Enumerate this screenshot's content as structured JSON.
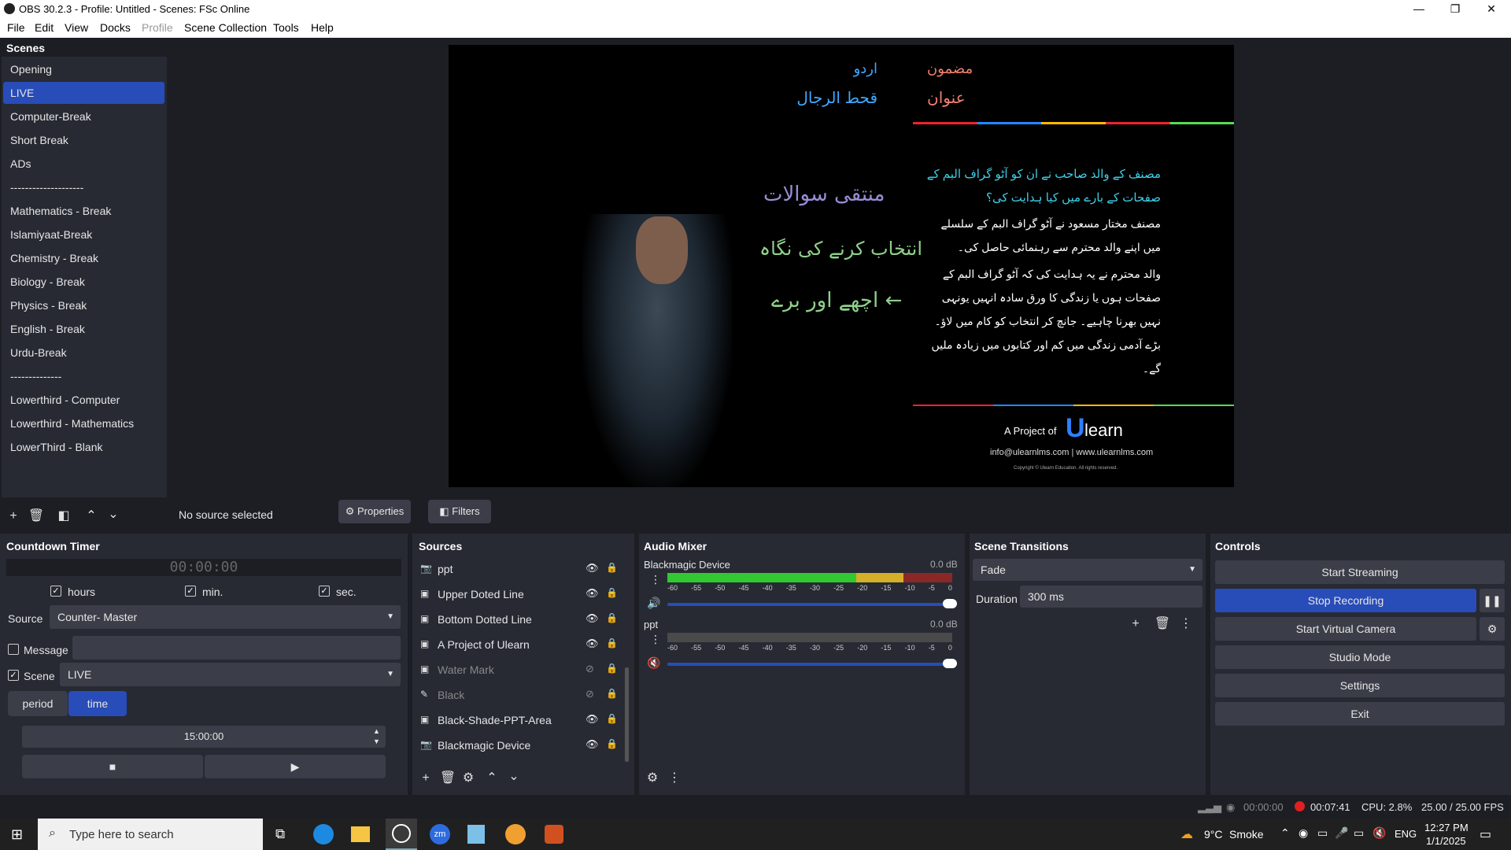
{
  "window": {
    "title": "OBS 30.2.3 - Profile: Untitled - Scenes: FSc Online"
  },
  "menu": [
    "File",
    "Edit",
    "View",
    "Docks",
    "Profile",
    "Scene Collection",
    "Tools",
    "Help"
  ],
  "scenes": {
    "title": "Scenes",
    "items": [
      "Opening",
      "LIVE",
      "Computer-Break",
      "Short Break",
      "ADs",
      "--------------------",
      "Mathematics - Break",
      "Islamiyaat-Break",
      "Chemistry - Break",
      "Biology - Break",
      "Physics - Break",
      "English - Break",
      "Urdu-Break",
      "--------------",
      "Lowerthird - Computer",
      "Lowerthird - Mathematics",
      "LowerThird - Blank"
    ],
    "selected": "LIVE"
  },
  "preview": {
    "subject_label": "مضمون",
    "subject_value": "اردو",
    "topic_label": "عنوان",
    "topic_value": "قحط الرجال",
    "question": "مصنف کے والد صاحب نے ان کو آٹو گراف البم کے صفحات کے بارے میں کیا ہدایت کی؟",
    "answer_1": "مصنف مختار مسعود نے آٹو گراف البم کے سلسلے میں اپنے والد محترم سے رہنمائی حاصل کی۔",
    "answer_2": "والد محترم نے یہ ہدایت کی کہ آٹو گراف البم کے صفحات ہوں یا زندگی کا ورق سادہ انہیں یونہی نہیں بھرنا چاہیے۔ جانچ کر انتخاب کو کام میں لاؤ۔ بڑے آدمی زندگی میں کم اور کتابوں میں زیادہ ملیں گے۔",
    "board_1": "منتقی سوالات",
    "board_2": "انتخاب کرنے کی نگاہ",
    "board_3": "اچھے اور برے ←",
    "project_text": "A Project of",
    "brand": "learn",
    "contact": "info@ulearnlms.com | www.ulearnlms.com",
    "copyright": "Copyright © Ulearn Education. All rights reserved."
  },
  "source_bar": {
    "status": "No source selected",
    "properties": "Properties",
    "filters": "Filters"
  },
  "countdown": {
    "title": "Countdown Timer",
    "display": "00:00:00",
    "hours": "hours",
    "min": "min.",
    "sec": "sec.",
    "source_label": "Source",
    "source_value": "Counter- Master",
    "message_label": "Message",
    "scene_label": "Scene",
    "scene_value": "LIVE",
    "tab_period": "period",
    "tab_time": "time",
    "time_value": "15:00:00"
  },
  "sources": {
    "title": "Sources",
    "items": [
      {
        "name": "ppt",
        "icon": "camera-icon",
        "visible": true
      },
      {
        "name": "Upper Doted Line",
        "icon": "image-icon",
        "visible": true
      },
      {
        "name": "Bottom Dotted Line",
        "icon": "image-icon",
        "visible": true
      },
      {
        "name": "A Project of Ulearn",
        "icon": "image-icon",
        "visible": true
      },
      {
        "name": "Water Mark",
        "icon": "image-icon",
        "visible": false
      },
      {
        "name": "Black",
        "icon": "brush-icon",
        "visible": false
      },
      {
        "name": "Black-Shade-PPT-Area",
        "icon": "image-icon",
        "visible": true
      },
      {
        "name": "Blackmagic Device",
        "icon": "camera-icon",
        "visible": true
      }
    ]
  },
  "mixer": {
    "title": "Audio Mixer",
    "channels": [
      {
        "name": "Blackmagic Device",
        "db": "0.0 dB",
        "muted": false,
        "level": 0.8
      },
      {
        "name": "ppt",
        "db": "0.0 dB",
        "muted": true,
        "level": 0.0
      }
    ],
    "scale": [
      "-60",
      "-55",
      "-50",
      "-45",
      "-40",
      "-35",
      "-30",
      "-25",
      "-20",
      "-15",
      "-10",
      "-5",
      "0"
    ]
  },
  "transitions": {
    "title": "Scene Transitions",
    "type": "Fade",
    "duration_label": "Duration",
    "duration_value": "300 ms"
  },
  "controls": {
    "title": "Controls",
    "start_streaming": "Start Streaming",
    "stop_recording": "Stop Recording",
    "start_virtual_camera": "Start Virtual Camera",
    "studio_mode": "Studio Mode",
    "settings": "Settings",
    "exit": "Exit"
  },
  "status": {
    "stream_time": "00:00:00",
    "rec_time": "00:07:41",
    "cpu": "CPU: 2.8%",
    "fps": "25.00 / 25.00 FPS"
  },
  "taskbar": {
    "search_placeholder": "Type here to search",
    "weather": "9°C",
    "weather_desc": "Smoke",
    "lang": "ENG",
    "time": "12:27 PM",
    "date": "1/1/2025"
  },
  "colors": {
    "accent": "#284cb8",
    "recording": "#e02020"
  }
}
